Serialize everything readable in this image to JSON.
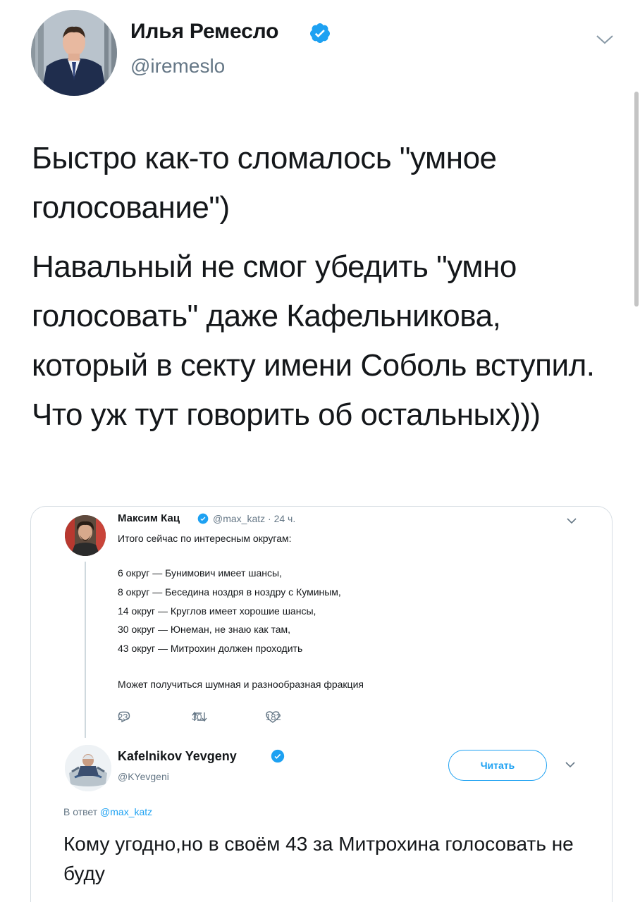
{
  "tweet": {
    "author_name": "Илья Ремесло",
    "handle": "@iremeslo",
    "paragraphs": [
      "Быстро как-то сломалось \"умное голосование\")",
      "Навальный не смог убедить \"умно голосовать\" даже Кафельникова, который в секту имени Соболь вступил. Что уж тут говорить об остальных)))"
    ],
    "icons": {
      "verified": "verified-badge-icon",
      "menu": "chevron-down-icon"
    }
  },
  "embedded": {
    "quoted": {
      "author_name": "Максим Кац",
      "meta": "@max_katz · 24 ч.",
      "lines": [
        "Итого сейчас по интересным округам:",
        "6 округ — Бунимович имеет шансы,",
        "8 округ — Беседина ноздря в ноздру с Куминым,",
        "14 округ — Круглов имеет хорошие шансы,",
        "30 округ — Юнеман, не знаю как там,",
        "43 округ — Митрохин должен проходить",
        "Может получиться шумная и разнообразная фракция"
      ],
      "actions": {
        "replies": "23",
        "retweets": "30",
        "likes": "182"
      }
    },
    "reply": {
      "author_name": "Kafelnikov Yevgeny",
      "handle": "@KYevgeni",
      "follow_label": "Читать",
      "reply_prefix": "В ответ",
      "reply_to": "@max_katz",
      "text": "Кому угодно,но в своём 43 за Митрохина голосовать не буду"
    }
  },
  "colors": {
    "accent": "#1da1f2",
    "text": "#14171a",
    "secondary": "#657786"
  }
}
